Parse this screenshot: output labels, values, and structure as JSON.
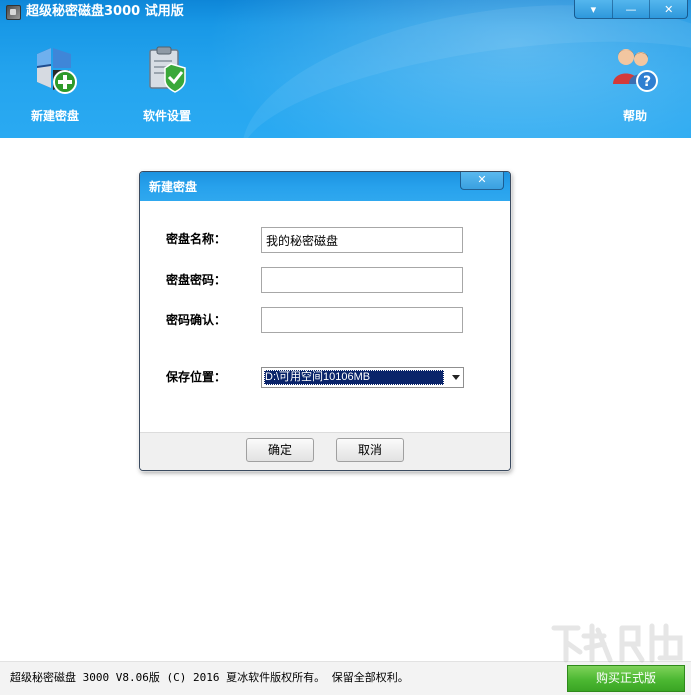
{
  "window": {
    "title": "超级秘密磁盘3000 试用版",
    "buttons": {
      "menu_glyph": "▾",
      "minimize_glyph": "—",
      "close_glyph": "✕"
    }
  },
  "toolbar": {
    "items": [
      {
        "label": "新建密盘",
        "icon": "new-disk-icon"
      },
      {
        "label": "软件设置",
        "icon": "settings-clipboard-icon"
      },
      {
        "label": "帮助",
        "icon": "help-users-icon"
      }
    ]
  },
  "dialog": {
    "title": "新建密盘",
    "close_glyph": "✕",
    "fields": {
      "name": {
        "label": "密盘名称：",
        "value": "我的秘密磁盘"
      },
      "password": {
        "label": "密盘密码：",
        "value": ""
      },
      "confirm": {
        "label": "密码确认：",
        "value": ""
      },
      "location": {
        "label": "保存位置：",
        "selected": "D:\\可用空间10106MB"
      }
    },
    "buttons": {
      "ok": "确定",
      "cancel": "取消"
    }
  },
  "statusbar": {
    "copyright": "超级秘密磁盘 3000 V8.06版  (C) 2016 夏冰软件版权所有。 保留全部权利。",
    "buy_button": "购买正式版"
  },
  "colors": {
    "header_blue": "#24a4ee",
    "dialog_title_blue": "#27a1ec",
    "selection_navy": "#0a246a",
    "buy_green": "#4cb832"
  }
}
